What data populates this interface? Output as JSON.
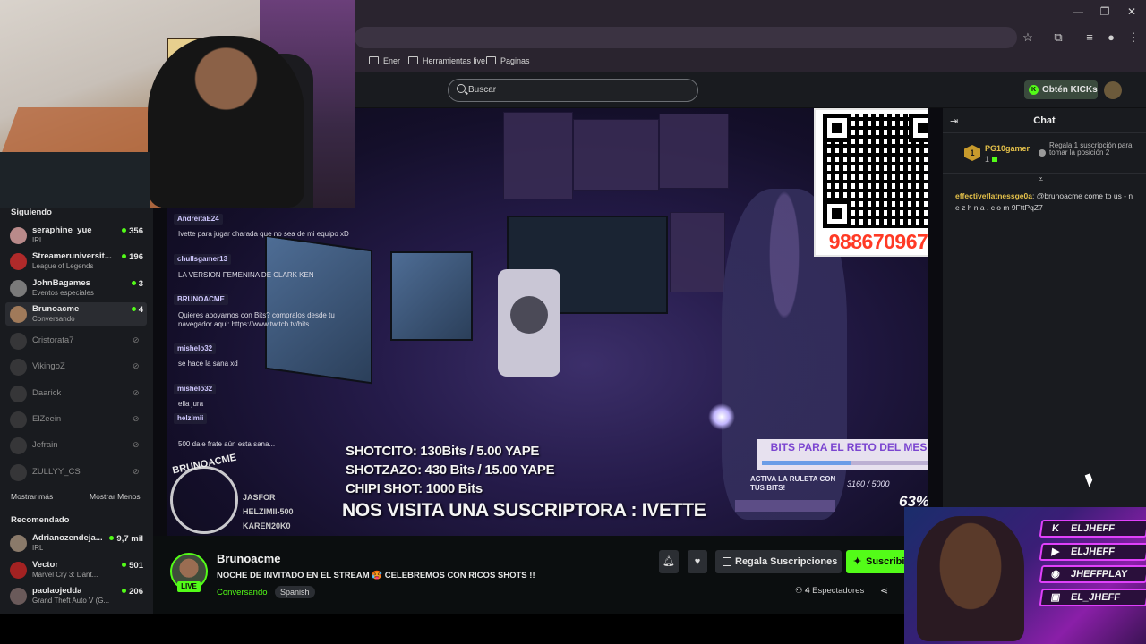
{
  "browser": {
    "bookmarks": [
      "Ener",
      "Herramientas live",
      "Paginas"
    ],
    "window_controls": [
      "minimize-icon",
      "restore-icon",
      "close-icon"
    ]
  },
  "header": {
    "search_placeholder": "Buscar",
    "get_kicks_label": "Obtén KICKs"
  },
  "sidebar": {
    "following_title": "Siguiendo",
    "following": [
      {
        "name": "seraphine_yue",
        "category": "IRL",
        "viewers": "356",
        "live": true
      },
      {
        "name": "Streameruniversit...",
        "category": "League of Legends",
        "viewers": "196",
        "live": true
      },
      {
        "name": "JohnBagames",
        "category": "Eventos especiales",
        "viewers": "3",
        "live": true
      },
      {
        "name": "Brunoacme",
        "category": "Conversando",
        "viewers": "4",
        "live": true
      },
      {
        "name": "Cristorata7",
        "live": false
      },
      {
        "name": "VikingoZ",
        "live": false
      },
      {
        "name": "Daarick",
        "live": false
      },
      {
        "name": "ElZeein",
        "live": false
      },
      {
        "name": "Jefrain",
        "live": false
      },
      {
        "name": "ZULLYY_CS",
        "live": false
      }
    ],
    "show_more": "Mostrar más",
    "show_less": "Mostrar Menos",
    "recommended_title": "Recomendado",
    "recommended": [
      {
        "name": "Adrianozendeja...",
        "category": "IRL",
        "viewers": "9,7 mil"
      },
      {
        "name": "Vector",
        "category": "Marvel Cry 3: Dant...",
        "viewers": "501"
      },
      {
        "name": "paolaojedda",
        "category": "Grand Theft Auto V (G...",
        "viewers": "206"
      }
    ]
  },
  "stream_overlay": {
    "qr_phone": "988670967",
    "prices": [
      "SHOTCITO: 130Bits  /  5.00 YAPE",
      "SHOTZAZO: 430 Bits  /  15.00 YAPE",
      "CHIPI SHOT: 1000 Bits"
    ],
    "announcement": "NOS VISITA UNA SUSCRIPTORA : IVETTE",
    "bits_goal_title": "BITS PARA EL RETO DEL MES!",
    "bits_goal_progress": 0.5,
    "roulette_text": "ACTIVA LA RULETA CON TUS BITS!",
    "bits_count": "3160 / 5000",
    "percent": "63%",
    "logo_text": "BRUNOACME",
    "socials": [
      "JASFOR",
      "HELZIMII-500",
      "KAREN20K0"
    ],
    "chat": [
      {
        "user": "AndreitaE24",
        "message": "Ivette para jugar charada que no sea de mi equipo xD"
      },
      {
        "user": "chullsgamer13",
        "message": "LA VERSION FEMENINA DE CLARK KEN"
      },
      {
        "user": "BRUNOACME",
        "message": "Quieres apoyarnos con Bits? compralos desde tu navegador aqui: https://www.twitch.tv/bits"
      },
      {
        "user": "mishelo32",
        "message": "se hace la sana xd"
      },
      {
        "user": "mishelo32",
        "message": "ella jura"
      },
      {
        "user": "helzimii",
        "message": "500 dale frate aún esta sana..."
      }
    ]
  },
  "channel": {
    "name": "Brunoacme",
    "live_badge": "LIVE",
    "title": "NOCHE DE INVITADO EN EL STREAM 🥵 CELEBREMOS CON RICOS SHOTS !!",
    "category": "Conversando",
    "language": "Spanish",
    "gift_subs_label": "Regala Suscripciones",
    "subscribe_label": "Suscribirse",
    "viewers_count": "4",
    "viewers_label": "Espectadores"
  },
  "chat": {
    "title": "Chat",
    "pinned": {
      "user": "PG10gamer",
      "rank": "1",
      "count": "1",
      "gift_text": "Regala 1 suscripción para tomar la posición 2"
    },
    "messages": [
      {
        "user": "effectiveflatnessge0a",
        "text": "@brunoacme come to us - n e z h n a . c o m 9FttPqZ7"
      }
    ]
  },
  "overlay_socials": [
    {
      "icon": "kick-icon",
      "label": "ELJHEFF"
    },
    {
      "icon": "youtube-icon",
      "label": "ELJHEFF"
    },
    {
      "icon": "discord-icon",
      "label": "JHEFFPLAY"
    },
    {
      "icon": "twitch-icon",
      "label": "EL_JHEFF"
    }
  ]
}
